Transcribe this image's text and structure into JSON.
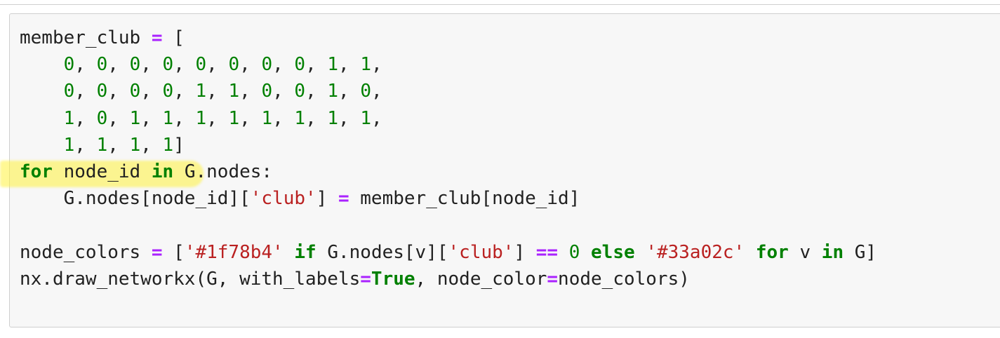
{
  "code_lines": [
    [
      {
        "text": "member_club ",
        "type": "plain"
      },
      {
        "text": "=",
        "type": "op"
      },
      {
        "text": " [",
        "type": "plain"
      }
    ],
    [
      {
        "text": "    ",
        "type": "plain"
      },
      {
        "text": "0",
        "type": "num"
      },
      {
        "text": ", ",
        "type": "plain"
      },
      {
        "text": "0",
        "type": "num"
      },
      {
        "text": ", ",
        "type": "plain"
      },
      {
        "text": "0",
        "type": "num"
      },
      {
        "text": ", ",
        "type": "plain"
      },
      {
        "text": "0",
        "type": "num"
      },
      {
        "text": ", ",
        "type": "plain"
      },
      {
        "text": "0",
        "type": "num"
      },
      {
        "text": ", ",
        "type": "plain"
      },
      {
        "text": "0",
        "type": "num"
      },
      {
        "text": ", ",
        "type": "plain"
      },
      {
        "text": "0",
        "type": "num"
      },
      {
        "text": ", ",
        "type": "plain"
      },
      {
        "text": "0",
        "type": "num"
      },
      {
        "text": ", ",
        "type": "plain"
      },
      {
        "text": "1",
        "type": "num"
      },
      {
        "text": ", ",
        "type": "plain"
      },
      {
        "text": "1",
        "type": "num"
      },
      {
        "text": ",",
        "type": "plain"
      }
    ],
    [
      {
        "text": "    ",
        "type": "plain"
      },
      {
        "text": "0",
        "type": "num"
      },
      {
        "text": ", ",
        "type": "plain"
      },
      {
        "text": "0",
        "type": "num"
      },
      {
        "text": ", ",
        "type": "plain"
      },
      {
        "text": "0",
        "type": "num"
      },
      {
        "text": ", ",
        "type": "plain"
      },
      {
        "text": "0",
        "type": "num"
      },
      {
        "text": ", ",
        "type": "plain"
      },
      {
        "text": "1",
        "type": "num"
      },
      {
        "text": ", ",
        "type": "plain"
      },
      {
        "text": "1",
        "type": "num"
      },
      {
        "text": ", ",
        "type": "plain"
      },
      {
        "text": "0",
        "type": "num"
      },
      {
        "text": ", ",
        "type": "plain"
      },
      {
        "text": "0",
        "type": "num"
      },
      {
        "text": ", ",
        "type": "plain"
      },
      {
        "text": "1",
        "type": "num"
      },
      {
        "text": ", ",
        "type": "plain"
      },
      {
        "text": "0",
        "type": "num"
      },
      {
        "text": ",",
        "type": "plain"
      }
    ],
    [
      {
        "text": "    ",
        "type": "plain"
      },
      {
        "text": "1",
        "type": "num"
      },
      {
        "text": ", ",
        "type": "plain"
      },
      {
        "text": "0",
        "type": "num"
      },
      {
        "text": ", ",
        "type": "plain"
      },
      {
        "text": "1",
        "type": "num"
      },
      {
        "text": ", ",
        "type": "plain"
      },
      {
        "text": "1",
        "type": "num"
      },
      {
        "text": ", ",
        "type": "plain"
      },
      {
        "text": "1",
        "type": "num"
      },
      {
        "text": ", ",
        "type": "plain"
      },
      {
        "text": "1",
        "type": "num"
      },
      {
        "text": ", ",
        "type": "plain"
      },
      {
        "text": "1",
        "type": "num"
      },
      {
        "text": ", ",
        "type": "plain"
      },
      {
        "text": "1",
        "type": "num"
      },
      {
        "text": ", ",
        "type": "plain"
      },
      {
        "text": "1",
        "type": "num"
      },
      {
        "text": ", ",
        "type": "plain"
      },
      {
        "text": "1",
        "type": "num"
      },
      {
        "text": ",",
        "type": "plain"
      }
    ],
    [
      {
        "text": "    ",
        "type": "plain"
      },
      {
        "text": "1",
        "type": "num"
      },
      {
        "text": ", ",
        "type": "plain"
      },
      {
        "text": "1",
        "type": "num"
      },
      {
        "text": ", ",
        "type": "plain"
      },
      {
        "text": "1",
        "type": "num"
      },
      {
        "text": ", ",
        "type": "plain"
      },
      {
        "text": "1",
        "type": "num"
      },
      {
        "text": "]",
        "type": "plain"
      }
    ],
    [
      {
        "text": "for",
        "type": "kw"
      },
      {
        "text": " node_id ",
        "type": "plain"
      },
      {
        "text": "in",
        "type": "kw"
      },
      {
        "text": " G.nodes:",
        "type": "plain"
      }
    ],
    [
      {
        "text": "    G.nodes[node_id][",
        "type": "plain"
      },
      {
        "text": "'club'",
        "type": "str"
      },
      {
        "text": "] ",
        "type": "plain"
      },
      {
        "text": "=",
        "type": "op"
      },
      {
        "text": " member_club[node_id]",
        "type": "plain"
      }
    ],
    [],
    [
      {
        "text": "node_colors ",
        "type": "plain"
      },
      {
        "text": "=",
        "type": "op"
      },
      {
        "text": " [",
        "type": "plain"
      },
      {
        "text": "'#1f78b4'",
        "type": "str"
      },
      {
        "text": " ",
        "type": "plain"
      },
      {
        "text": "if",
        "type": "kw"
      },
      {
        "text": " G.nodes[v][",
        "type": "plain"
      },
      {
        "text": "'club'",
        "type": "str"
      },
      {
        "text": "] ",
        "type": "plain"
      },
      {
        "text": "==",
        "type": "op"
      },
      {
        "text": " ",
        "type": "plain"
      },
      {
        "text": "0",
        "type": "num"
      },
      {
        "text": " ",
        "type": "plain"
      },
      {
        "text": "else",
        "type": "kw"
      },
      {
        "text": " ",
        "type": "plain"
      },
      {
        "text": "'#33a02c'",
        "type": "str"
      },
      {
        "text": " ",
        "type": "plain"
      },
      {
        "text": "for",
        "type": "kw"
      },
      {
        "text": " v ",
        "type": "plain"
      },
      {
        "text": "in",
        "type": "kw"
      },
      {
        "text": " G]",
        "type": "plain"
      }
    ],
    [
      {
        "text": "nx.draw_networkx(G, with_labels",
        "type": "plain"
      },
      {
        "text": "=",
        "type": "op"
      },
      {
        "text": "True",
        "type": "kw"
      },
      {
        "text": ", node_color",
        "type": "plain"
      },
      {
        "text": "=",
        "type": "op"
      },
      {
        "text": "node_colors)",
        "type": "plain"
      }
    ]
  ],
  "colors": {
    "cell_background": "#f7f7f7",
    "cell_border": "#cfcfcf",
    "plain_text": "#212121",
    "operator": "#aa22ff",
    "number": "#008000",
    "keyword": "#008000",
    "string": "#ba2121",
    "highlight": "#fff23c"
  }
}
